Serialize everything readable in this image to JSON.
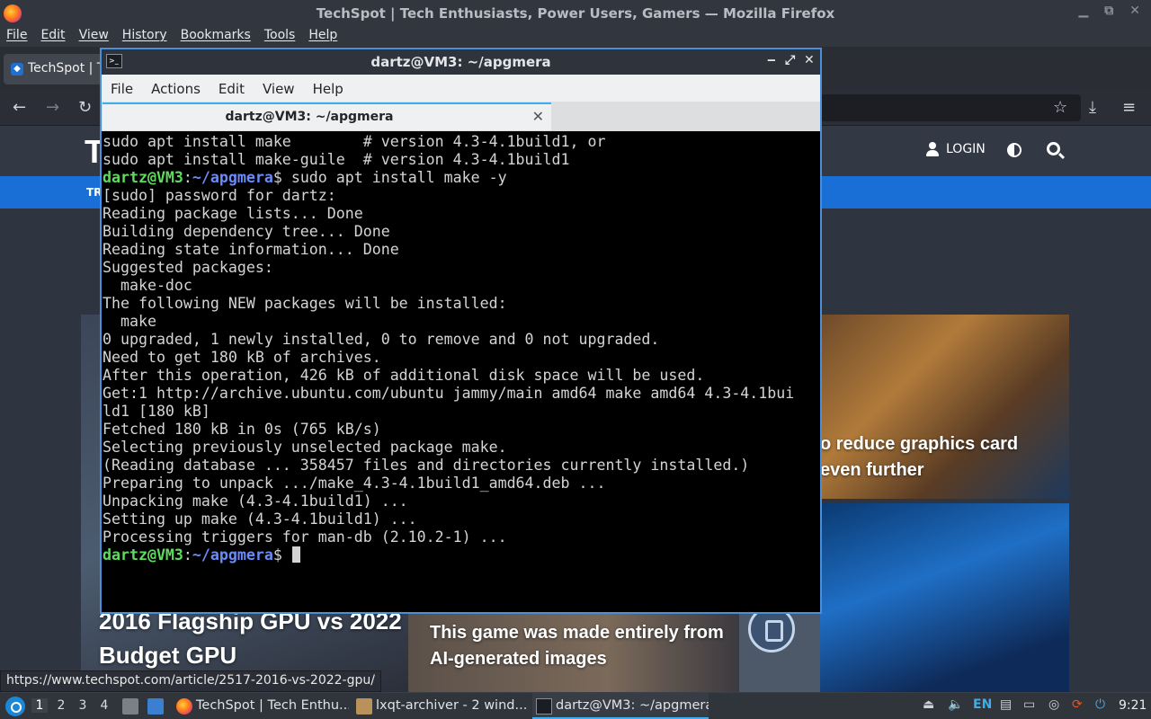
{
  "firefox": {
    "window_title": "TechSpot | Tech Enthusiasts, Power Users, Gamers — Mozilla Firefox",
    "menu": [
      "File",
      "Edit",
      "View",
      "History",
      "Bookmarks",
      "Tools",
      "Help"
    ],
    "tab_label": "TechSpot | T",
    "status_url": "https://www.techspot.com/article/2517-2016-vs-2022-gpu/"
  },
  "site": {
    "logo": "T",
    "login": "LOGIN",
    "nav_partial": "TR",
    "headline_left": "2016 Flagship GPU vs 2022 Budget GPU",
    "headline_mid": "This game was made entirely from AI-generated images",
    "headline_right": "o reduce graphics card even further"
  },
  "terminal": {
    "title": "dartz@VM3: ~/apgmera",
    "menu": [
      "File",
      "Actions",
      "Edit",
      "View",
      "Help"
    ],
    "tab_label": "dartz@VM3: ~/apgmera",
    "prompt_user": "dartz@VM3",
    "prompt_sep": ":",
    "prompt_path": "~/apgmera",
    "prompt_end": "$ ",
    "command": "sudo apt install make -y",
    "lines_before": [
      "sudo apt install make        # version 4.3-4.1build1, or",
      "sudo apt install make-guile  # version 4.3-4.1build1"
    ],
    "output": [
      "[sudo] password for dartz:",
      "Reading package lists... Done",
      "Building dependency tree... Done",
      "Reading state information... Done",
      "Suggested packages:",
      "  make-doc",
      "The following NEW packages will be installed:",
      "  make",
      "0 upgraded, 1 newly installed, 0 to remove and 0 not upgraded.",
      "Need to get 180 kB of archives.",
      "After this operation, 426 kB of additional disk space will be used.",
      "Get:1 http://archive.ubuntu.com/ubuntu jammy/main amd64 make amd64 4.3-4.1bui",
      "ld1 [180 kB]",
      "Fetched 180 kB in 0s (765 kB/s)",
      "Selecting previously unselected package make.",
      "(Reading database ... 358457 files and directories currently installed.)",
      "Preparing to unpack .../make_4.3-4.1build1_amd64.deb ...",
      "Unpacking make (4.3-4.1build1) ...",
      "Setting up make (4.3-4.1build1) ...",
      "Processing triggers for man-db (2.10.2-1) ..."
    ]
  },
  "taskbar": {
    "workspaces": [
      "1",
      "2",
      "3",
      "4"
    ],
    "active_workspace": "1",
    "items": [
      "TechSpot | Tech Enthu...",
      "lxqt-archiver - 2 wind...",
      "dartz@VM3: ~/apgmera"
    ],
    "keyboard_layout": "EN",
    "clock": "9:21"
  },
  "colors": {
    "accent": "#3daee9",
    "prompt_user": "#5fdc5f",
    "prompt_path": "#6b8cf8",
    "site_nav": "#1a6fd6"
  }
}
